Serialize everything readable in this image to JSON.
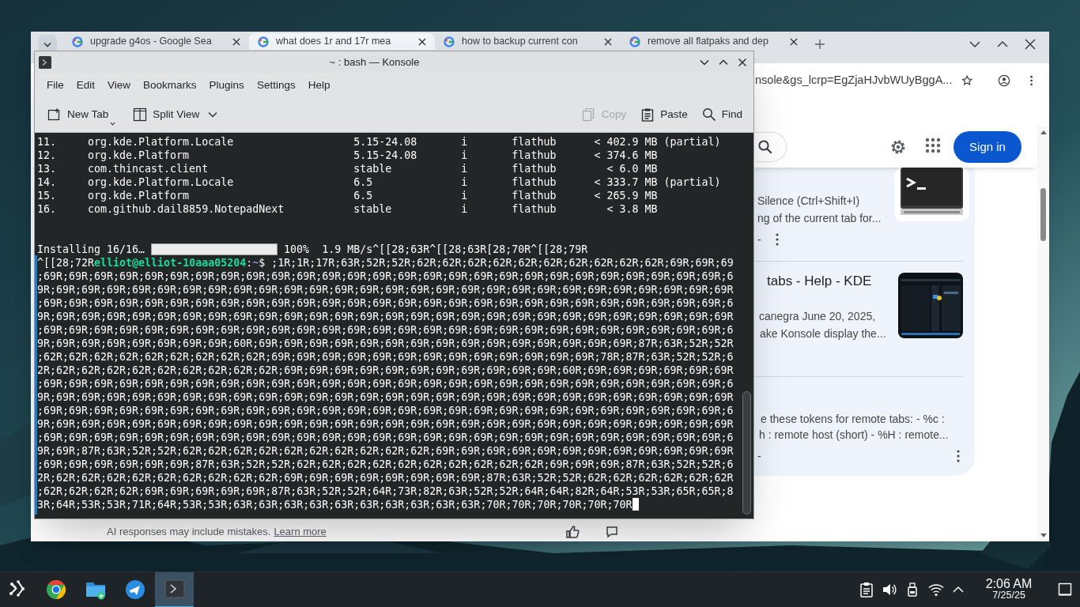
{
  "browser": {
    "tabs": [
      {
        "title": "upgrade g4os - Google Sea",
        "selected": false
      },
      {
        "title": "what does 1r and 17r mea",
        "selected": true
      },
      {
        "title": "how to backup current con",
        "selected": false
      },
      {
        "title": "remove all flatpaks and dep",
        "selected": false
      }
    ],
    "url": "nsole&gs_lcrp=EgZjaHJvbWUyBggA...",
    "sign_in": "Sign in",
    "results": [
      {
        "lines": [
          "Silence (Ctrl+Shift+I)",
          "ng of the current tab for..."
        ],
        "source": "-"
      },
      {
        "title": "tabs - Help - KDE",
        "lines": [
          "canegra June 20, 2025,",
          "ake Konsole display the..."
        ]
      },
      {
        "lines": [
          "e these tokens for remote tabs: - %c :",
          "h : remote host (short) - %H : remote..."
        ],
        "source": "-"
      }
    ],
    "disclaimer": "AI responses may include mistakes.",
    "disclaimer_link": "Learn more"
  },
  "terminal": {
    "title": "~ : bash — Konsole",
    "menu": [
      "File",
      "Edit",
      "View",
      "Bookmarks",
      "Plugins",
      "Settings",
      "Help"
    ],
    "toolbar": [
      {
        "label": "New Tab",
        "kind": "new-tab",
        "disabled": false
      },
      {
        "label": "Split View",
        "kind": "split",
        "disabled": false
      },
      {
        "label": "Copy",
        "kind": "copy",
        "disabled": true
      },
      {
        "label": "Paste",
        "kind": "paste",
        "disabled": false
      },
      {
        "label": "Find",
        "kind": "find",
        "disabled": false
      }
    ],
    "rows": [
      {
        "num": "11.",
        "name": "org.kde.Platform.Locale",
        "version": "5.15-24.08",
        "op": "i",
        "remote": "flathub",
        "size": "< 402.9 MB",
        "note": "(partial)"
      },
      {
        "num": "12.",
        "name": "org.kde.Platform",
        "version": "5.15-24.08",
        "op": "i",
        "remote": "flathub",
        "size": "< 374.6 MB"
      },
      {
        "num": "13.",
        "name": "com.thincast.client",
        "version": "stable",
        "op": "i",
        "remote": "flathub",
        "size": "< 6.0 MB"
      },
      {
        "num": "14.",
        "name": "org.kde.Platform.Locale",
        "version": "6.5",
        "op": "i",
        "remote": "flathub",
        "size": "< 333.7 MB",
        "note": "(partial)"
      },
      {
        "num": "15.",
        "name": "org.kde.Platform",
        "version": "6.5",
        "op": "i",
        "remote": "flathub",
        "size": "< 265.9 MB"
      },
      {
        "num": "16.",
        "name": "com.github.dail8859.NotepadNext",
        "version": "stable",
        "op": "i",
        "remote": "flathub",
        "size": "< 3.8 MB"
      }
    ],
    "progress": {
      "label": "Installing 16/16…",
      "level": 1,
      "percent": "100%",
      "tail": "1.9 MB/s^[[28;63R^[[28;63R[28;70R^[[28;79R"
    },
    "prompt": {
      "prefix": "^[[28;72R",
      "user_host": "elliot@elliot-10aaa05204",
      "separator": ":",
      "path": "~",
      "symbol": "$",
      "input": ";1R;1R;17R;63R;52R;52R;62R;62R;62R;62R;62R;62R;62R;62R;62R;62R;69R;69R;69"
    },
    "output_lines": [
      ";69R;69R;69R;69R;69R;69R;69R;69R;69R;69R;69R;69R;69R;69R;69R;69R;69R;69R;69R;69R;69R;69R;69R;69R;69R;69R;69R;6",
      "9R;69R;69R;69R;69R;69R;69R;69R;69R;69R;69R;69R;69R;69R;69R;69R;69R;69R;69R;69R;69R;69R;69R;69R;69R;69R;69R;69R",
      ";69R;69R;69R;69R;69R;69R;69R;69R;69R;69R;69R;69R;69R;69R;69R;69R;69R;69R;69R;69R;69R;69R;69R;69R;69R;69R;69R;6",
      "9R;69R;69R;69R;69R;69R;69R;69R;69R;69R;69R;69R;69R;69R;69R;69R;69R;69R;69R;69R;69R;69R;69R;69R;69R;69R;69R;69R",
      ";69R;69R;69R;69R;69R;69R;69R;69R;69R;69R;69R;69R;69R;69R;69R;69R;69R;69R;69R;69R;69R;69R;69R;69R;69R;69R;69R;6",
      "9R;69R;69R;69R;69R;69R;69R;69R;60R;69R;69R;69R;69R;69R;69R;69R;69R;69R;69R;69R;69R;69R;69R;69R;87R;63R;52R;52R",
      ";62R;62R;62R;62R;62R;62R;62R;62R;62R;69R;69R;69R;69R;69R;69R;69R;69R;69R;69R;69R;69R;69R;78R;87R;63R;52R;52R;6",
      "2R;62R;62R;62R;62R;62R;62R;62R;62R;62R;69R;69R;69R;69R;69R;69R;69R;69R;69R;69R;69R;60R;69R;69R;69R;69R;69R;69R",
      ";69R;69R;69R;69R;69R;69R;69R;69R;69R;69R;69R;69R;69R;69R;69R;69R;69R;69R;69R;69R;69R;69R;69R;69R;69R;69R;69R;6",
      "9R;69R;69R;69R;69R;69R;69R;69R;69R;69R;69R;69R;69R;69R;69R;69R;69R;69R;69R;69R;69R;69R;69R;69R;69R;69R;69R;69R",
      ";69R;69R;69R;69R;69R;69R;69R;69R;69R;69R;69R;69R;69R;69R;69R;69R;69R;69R;69R;69R;69R;69R;69R;69R;69R;69R;69R;6",
      "9R;69R;69R;69R;69R;69R;69R;69R;69R;69R;69R;69R;69R;69R;69R;69R;69R;69R;69R;69R;69R;69R;69R;69R;69R;69R;69R;69R",
      ";69R;69R;69R;69R;69R;69R;69R;69R;69R;69R;69R;69R;69R;69R;69R;69R;69R;69R;69R;69R;69R;69R;69R;69R;69R;69R;69R;6",
      "9R;69R;87R;63R;52R;52R;62R;62R;62R;62R;62R;62R;62R;62R;62R;62R;69R;69R;69R;69R;69R;69R;69R;69R;69R;69R;69R;69R",
      ";69R;69R;69R;69R;69R;69R;87R;63R;52R;52R;62R;62R;62R;62R;62R;62R;62R;62R;62R;62R;69R;69R;69R;87R;63R;52R;52R;6",
      "2R;62R;62R;62R;62R;62R;62R;62R;62R;62R;69R;69R;69R;69R;69R;69R;69R;69R;87R;63R;52R;52R;62R;62R;62R;62R;62R;62R",
      ";62R;62R;62R;62R;69R;69R;69R;69R;69R;87R;63R;52R;52R;64R;73R;82R;63R;52R;52R;64R;64R;82R;64R;53R;53R;65R;65R;8",
      "3R;64R;53R;53R;71R;64R;53R;53R;63R;63R;63R;63R;63R;63R;63R;63R;63R;63R;70R;70R;70R;70R;70R;70R"
    ]
  },
  "taskbar": {
    "apps": [
      {
        "kind": "launcher",
        "active": false
      },
      {
        "kind": "browser",
        "active": false
      },
      {
        "kind": "files",
        "active": false
      },
      {
        "kind": "plane",
        "active": false
      },
      {
        "kind": "terminal",
        "active": true
      }
    ],
    "time": "2:06 AM",
    "date": "7/25/25"
  }
}
